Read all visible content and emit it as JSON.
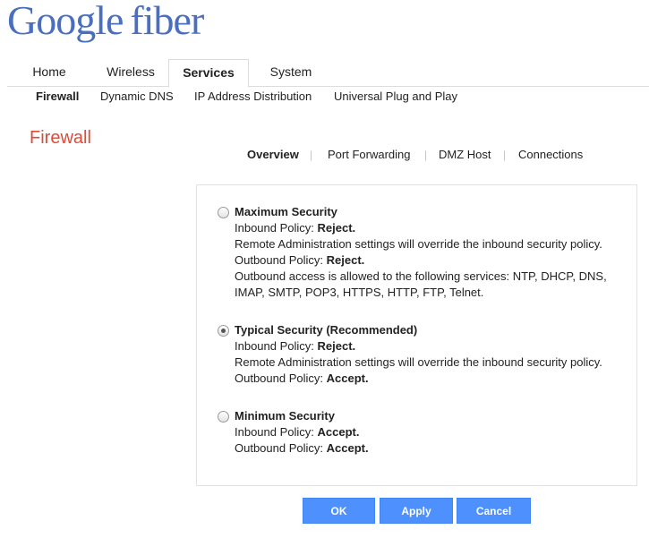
{
  "brand": {
    "word1": "Google",
    "word2": "fiber"
  },
  "main_tabs": [
    {
      "label": "Home"
    },
    {
      "label": "Wireless"
    },
    {
      "label": "Services"
    },
    {
      "label": "System"
    }
  ],
  "sub_nav": [
    {
      "label": "Firewall"
    },
    {
      "label": "Dynamic DNS"
    },
    {
      "label": "IP Address Distribution"
    },
    {
      "label": "Universal Plug and Play"
    }
  ],
  "page_title": "Firewall",
  "section_nav": [
    {
      "label": "Overview"
    },
    {
      "label": "Port Forwarding"
    },
    {
      "label": "DMZ Host"
    },
    {
      "label": "Connections"
    }
  ],
  "options": [
    {
      "title": "Maximum Security",
      "selected": false,
      "inbound_label": "Inbound Policy: ",
      "inbound_value": "Reject.",
      "remote_note": "Remote Administration settings will override the inbound security policy.",
      "outbound_label": "Outbound Policy: ",
      "outbound_value": "Reject.",
      "services_note": "Outbound access is allowed to the following services: NTP, DHCP, DNS, IMAP, SMTP, POP3, HTTPS, HTTP, FTP, Telnet."
    },
    {
      "title": "Typical Security (Recommended)",
      "selected": true,
      "inbound_label": "Inbound Policy: ",
      "inbound_value": "Reject.",
      "remote_note": "Remote Administration settings will override the inbound security policy.",
      "outbound_label": "Outbound Policy: ",
      "outbound_value": "Accept."
    },
    {
      "title": "Minimum Security",
      "selected": false,
      "inbound_label": "Inbound Policy: ",
      "inbound_value": "Accept.",
      "outbound_label": "Outbound Policy: ",
      "outbound_value": "Accept."
    }
  ],
  "buttons": {
    "ok": "OK",
    "apply": "Apply",
    "cancel": "Cancel"
  },
  "colors": {
    "accent_blue": "#4d90fe",
    "title_red": "#dd4b39",
    "logo_blue": "#4a6fbe"
  }
}
